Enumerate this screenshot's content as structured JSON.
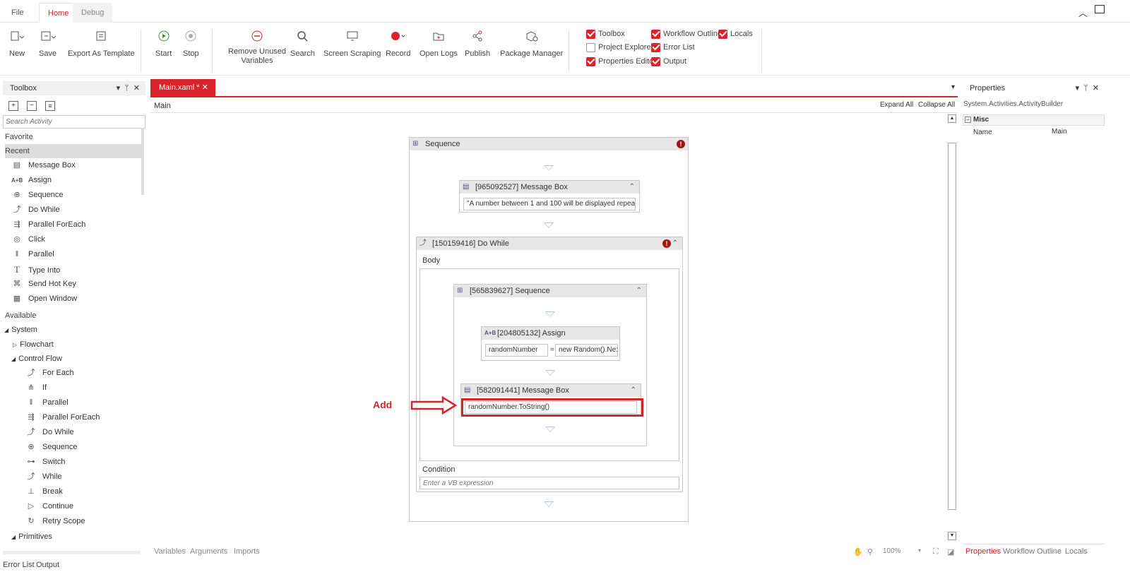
{
  "menu": {
    "file": "File",
    "home": "Home",
    "debug": "Debug"
  },
  "ribbon": {
    "new": "New",
    "save": "Save",
    "export": "Export As Template",
    "start": "Start",
    "stop": "Stop",
    "remove_unused_1": "Remove Unused",
    "remove_unused_2": "Variables",
    "search": "Search",
    "screen_scraping": "Screen Scraping",
    "record": "Record",
    "open_logs": "Open Logs",
    "publish": "Publish",
    "package_manager": "Package Manager"
  },
  "panels_checks": {
    "toolbox": "Toolbox",
    "workflow_outline": "Workflow Outline",
    "locals": "Locals",
    "project_explorer": "Project Explorer",
    "error_list": "Error List",
    "properties_editor": "Properties Editor",
    "output": "Output"
  },
  "toolbox": {
    "title": "Toolbox",
    "search_placeholder": "Search Activity",
    "favorite": "Favorite",
    "recent": "Recent",
    "recent_items": [
      "Message Box",
      "Assign",
      "Sequence",
      "Do While",
      "Parallel ForEach",
      "Click",
      "Parallel",
      "Type Into",
      "Send Hot Key",
      "Open Window"
    ],
    "available": "Available",
    "system": "System",
    "flowchart": "Flowchart",
    "control_flow": "Control Flow",
    "control_items": [
      "For Each",
      "If",
      "Parallel",
      "Parallel ForEach",
      "Do While",
      "Sequence",
      "Switch",
      "While",
      "Break",
      "Continue",
      "Retry Scope"
    ],
    "primitives": "Primitives"
  },
  "designer": {
    "tab": "Main.xaml *",
    "breadcrumb": "Main",
    "expand_all": "Expand All",
    "collapse_all": "Collapse All",
    "seq_title": "Sequence",
    "msg1_title": "[965092527] Message Box",
    "msg1_value": "\"A number between 1 and 100 will be displayed repeat",
    "dowhile_title": "[150159416] Do While",
    "body_label": "Body",
    "inner_seq_title": "[565839627] Sequence",
    "assign_title": "[204805132] Assign",
    "assign_to": "randomNumber",
    "assign_eq": "=",
    "assign_value": "new Random().Ne:",
    "msg2_title": "[582091441] Message Box",
    "msg2_value": "randomNumber.ToString()",
    "condition_label": "Condition",
    "condition_placeholder": "Enter a VB expression",
    "annotation": "Add"
  },
  "designer_footer": {
    "variables": "Variables",
    "arguments": "Arguments",
    "imports": "Imports",
    "zoom": "100%"
  },
  "properties": {
    "title": "Properties",
    "class": "System.Activities.ActivityBuilder",
    "section": "Misc",
    "name_label": "Name",
    "name_value": "Main",
    "tabs": [
      "Properties",
      "Workflow Outline",
      "Locals"
    ]
  },
  "bottom": {
    "error_list": "Error List",
    "output": "Output"
  },
  "colors": {
    "accent": "#d8232a",
    "header_gray": "#e6e6e6",
    "error": "#a31515"
  }
}
